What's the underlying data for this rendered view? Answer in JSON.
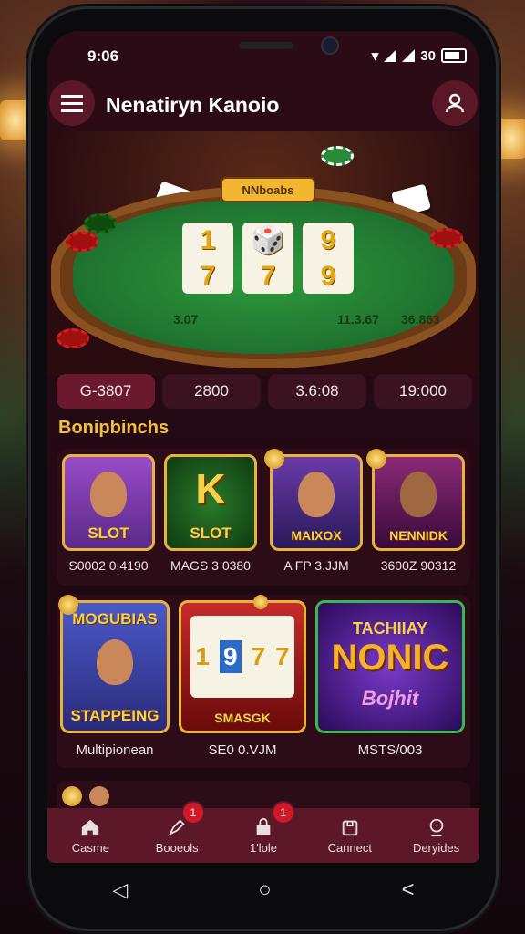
{
  "status_bar": {
    "time": "9:06",
    "right_text": "30"
  },
  "header": {
    "title": "Nenatiryn Kanoio",
    "menu_icon": "hamburger-icon",
    "user_icon": "user-icon"
  },
  "hero": {
    "banner": "NNboabs",
    "reels": [
      [
        "1",
        "7"
      ],
      [
        "🎲",
        "7"
      ],
      [
        "9",
        "9"
      ]
    ],
    "felt_texts": [
      "3.07",
      "11.3.67",
      "36.863"
    ]
  },
  "stats": [
    "G-3807",
    "2800",
    "3.6:08",
    "19:000"
  ],
  "section_title": "Bonipbinchs",
  "games_row1": [
    {
      "thumb_label": "SLOT",
      "caption": "S0002 0:4190",
      "bg": "#7a3aa8"
    },
    {
      "thumb_label": "SLOT",
      "caption": "MAGS 3 0380",
      "bg": "#1e5a20",
      "big_text": "K"
    },
    {
      "thumb_label": "MAIXOX",
      "caption": "A FP 3.JJM",
      "bg": "#4a2a7a"
    },
    {
      "thumb_label": "NENNIDK",
      "caption": "3600Z 90312",
      "bg": "#6a1a58"
    }
  ],
  "games_row2": [
    {
      "top_label": "MOGUBIAS",
      "bottom_label": "STAPPEING",
      "caption": "Multipionean",
      "bg": "#3a4ab0"
    },
    {
      "bottom_label": "SMASGK",
      "caption": "SE0 0.VJM",
      "bg": "#8a1a1a",
      "reels": [
        "1",
        "9",
        "7",
        "7"
      ]
    },
    {
      "top_label": "TACHIIAY",
      "big_label": "NONIC",
      "script_label": "Bojhit",
      "caption": "MSTS/003",
      "bg": "#3a1a8a"
    }
  ],
  "nav": [
    {
      "label": "Casme",
      "icon": "home-icon",
      "badge": ""
    },
    {
      "label": "Booeols",
      "icon": "rocket-icon",
      "badge": "1"
    },
    {
      "label": "1'lole",
      "icon": "bag-icon",
      "badge": "1"
    },
    {
      "label": "Cannect",
      "icon": "box-icon",
      "badge": ""
    },
    {
      "label": "Deryides",
      "icon": "profile-icon",
      "badge": ""
    }
  ]
}
